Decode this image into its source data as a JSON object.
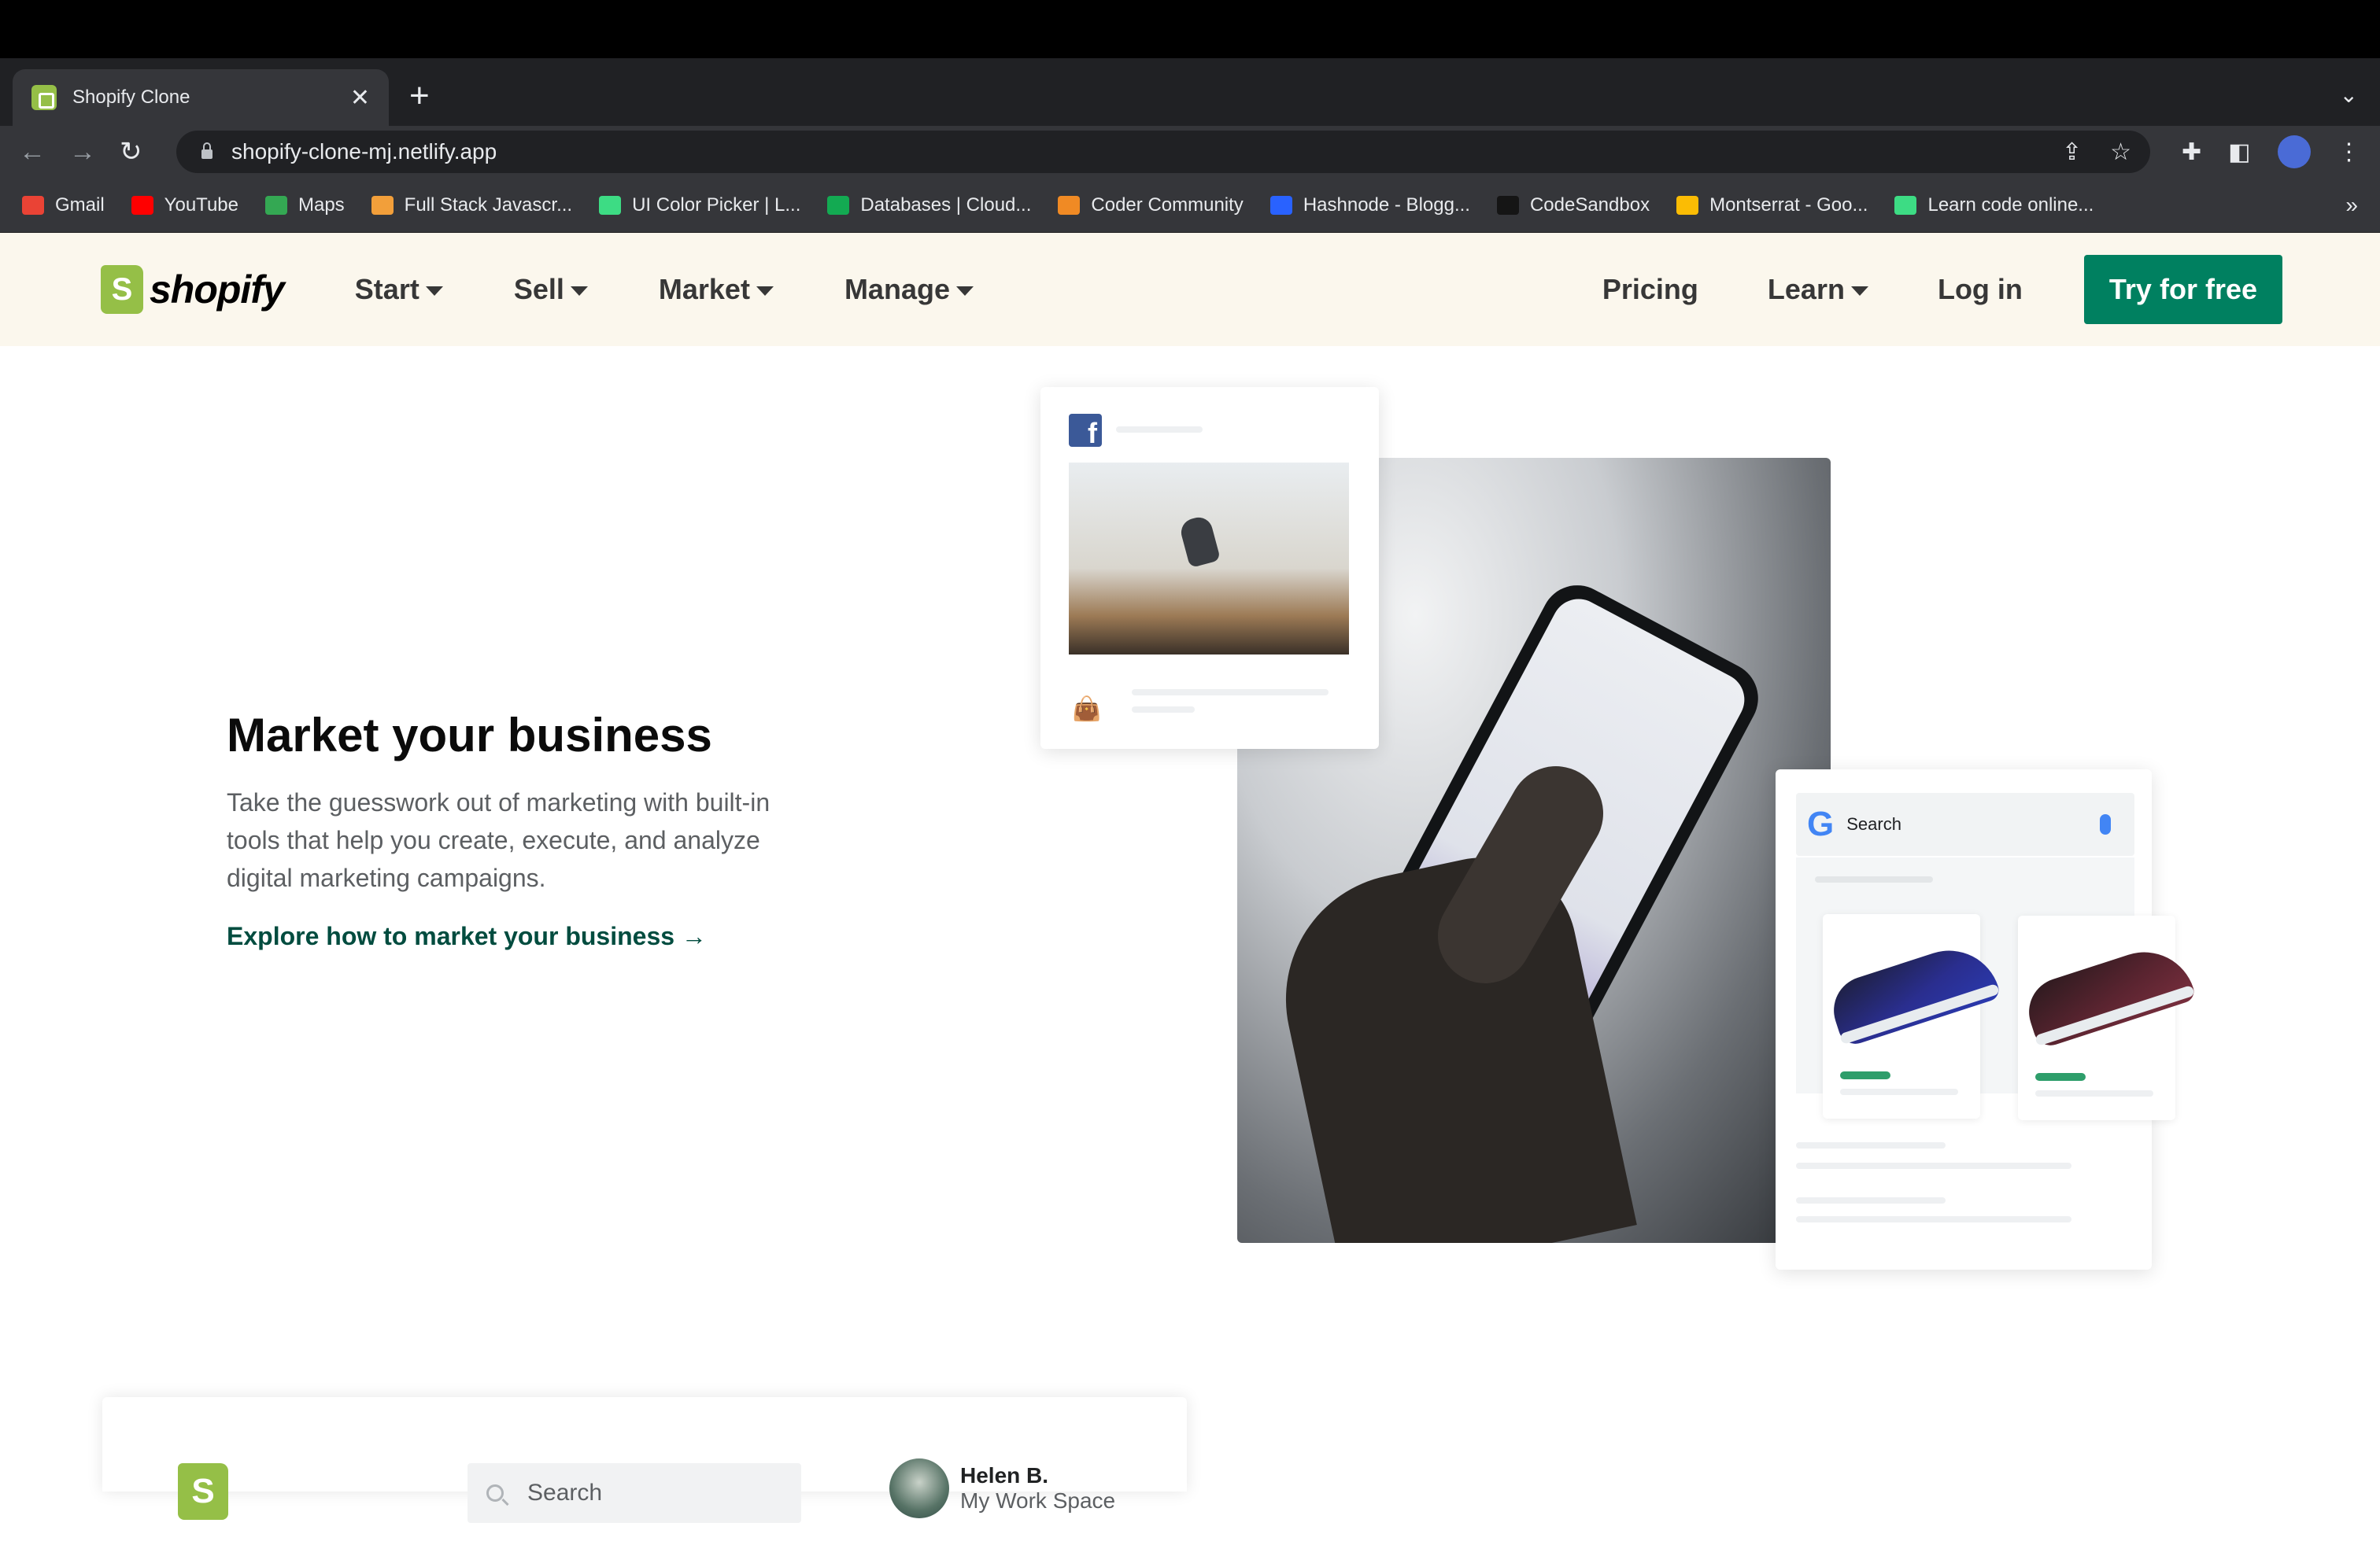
{
  "browser": {
    "tab_title": "Shopify Clone",
    "tab_close": "✕",
    "new_tab": "+",
    "tab_menu": "⌄",
    "url": "shopify-clone-mj.netlify.app",
    "bookmarks": [
      {
        "label": "Gmail",
        "icon": "gmail-icon",
        "color": "#ea4335"
      },
      {
        "label": "YouTube",
        "icon": "youtube-icon",
        "color": "#ff0000"
      },
      {
        "label": "Maps",
        "icon": "maps-icon",
        "color": "#34a853"
      },
      {
        "label": "Full Stack Javascr...",
        "icon": "course-icon",
        "color": "#f29f3a"
      },
      {
        "label": "UI Color Picker | L...",
        "icon": "bracket-icon",
        "color": "#3ddc84"
      },
      {
        "label": "Databases | Cloud...",
        "icon": "mongodb-icon",
        "color": "#13aa52"
      },
      {
        "label": "Coder Community",
        "icon": "braces-icon",
        "color": "#f08a24"
      },
      {
        "label": "Hashnode - Blogg...",
        "icon": "hashnode-icon",
        "color": "#2962ff"
      },
      {
        "label": "CodeSandbox",
        "icon": "codesandbox-icon",
        "color": "#151515"
      },
      {
        "label": "Montserrat - Goo...",
        "icon": "google-fonts-icon",
        "color": "#fbbc04"
      },
      {
        "label": "Learn code online...",
        "icon": "bracket-icon",
        "color": "#3ddc84"
      }
    ],
    "bookmarks_more": "»"
  },
  "header": {
    "logo_text": "shopify",
    "logo_letter": "S",
    "nav": [
      "Start",
      "Sell",
      "Market",
      "Manage"
    ],
    "pricing": "Pricing",
    "learn": "Learn",
    "login": "Log in",
    "cta": "Try for free"
  },
  "hero": {
    "title": "Market your business",
    "description": "Take the guesswork out of marketing with built-in tools that help you create, execute, and analyze digital marketing campaigns.",
    "link": "Explore how to market your business →"
  },
  "illustration": {
    "fb_letter": "f",
    "google_letter": "G",
    "google_search": "Search"
  },
  "admin_preview": {
    "logo_letter": "S",
    "search_placeholder": "Search",
    "user_name": "Helen B.",
    "workspace": "My Work Space"
  },
  "colors": {
    "brand_green": "#95bf47",
    "cta_green": "#008060",
    "header_bg": "#fbf7ed",
    "link_dark_green": "#004c3f"
  }
}
